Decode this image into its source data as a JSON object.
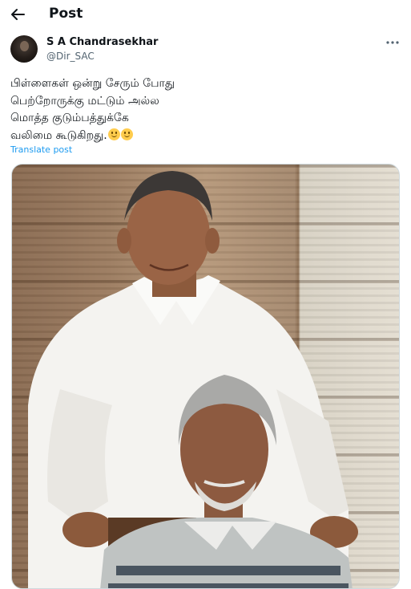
{
  "header": {
    "title": "Post",
    "back_icon": "arrow-left-icon"
  },
  "author": {
    "name": "S A Chandrasekhar",
    "handle": "@Dir_SAC",
    "avatar": "profile-photo"
  },
  "more_icon": "more-horizontal-icon",
  "tweet": {
    "lines": [
      "பிள்ளைகள் ஒன்று சேரும் போது",
      "பெற்றோருக்கு  மட்டும் அல்ல",
      "மொத்த குடும்பத்துக்கே",
      "வலிமை கூடுகிறது."
    ],
    "emoji": [
      "slightly-smiling-face",
      "slightly-smiling-face"
    ]
  },
  "translate_label": "Translate post",
  "media": {
    "kind": "photo",
    "subject": "two men posing, one standing behind the other who is seated"
  },
  "colors": {
    "link": "#1d9bf0",
    "secondary_text": "#536471",
    "border": "#cfd9de"
  }
}
